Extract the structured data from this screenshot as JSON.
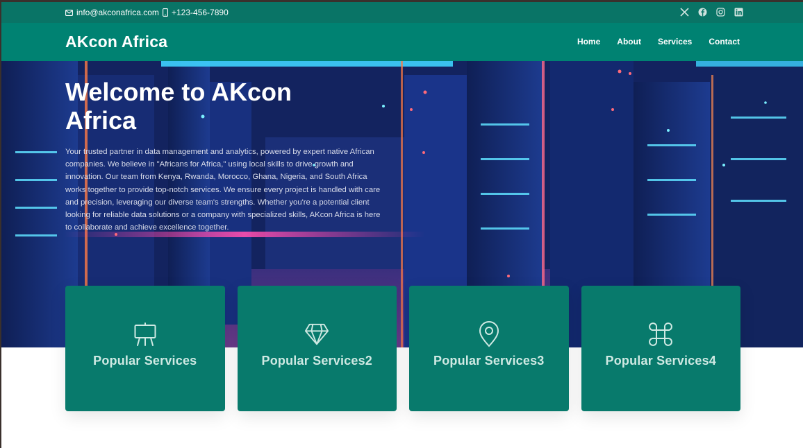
{
  "topbar": {
    "email": "info@akconafrica.com",
    "phone": "+123-456-7890",
    "social": [
      {
        "icon": "x-twitter-icon"
      },
      {
        "icon": "facebook-icon"
      },
      {
        "icon": "instagram-icon"
      },
      {
        "icon": "linkedin-icon"
      }
    ]
  },
  "nav": {
    "brand": "AKcon Africa",
    "items": [
      {
        "label": "Home"
      },
      {
        "label": "About"
      },
      {
        "label": "Services"
      },
      {
        "label": "Contact"
      }
    ]
  },
  "hero": {
    "title": "Welcome to AKcon Africa",
    "text": "Your trusted partner in data management and analytics, powered by expert native African companies. We believe in \"Africans for Africa,\" using local skills to drive growth and innovation. Our team from Kenya, Rwanda, Morocco, Ghana, Nigeria, and South Africa works together to provide top-notch services. We ensure every project is handled with care and precision, leveraging our diverse team's strengths. Whether you're a potential client looking for reliable data solutions or a company with specialized skills, AKcon Africa is here to collaborate and achieve excellence together."
  },
  "cards": [
    {
      "title": "Popular Services",
      "icon": "easel-icon"
    },
    {
      "title": "Popular Services2",
      "icon": "diamond-icon"
    },
    {
      "title": "Popular Services3",
      "icon": "map-pin-icon"
    },
    {
      "title": "Popular Services4",
      "icon": "command-icon"
    }
  ],
  "colors": {
    "topbar": "#097466",
    "navbar": "#008272",
    "card": "#087a6c"
  }
}
